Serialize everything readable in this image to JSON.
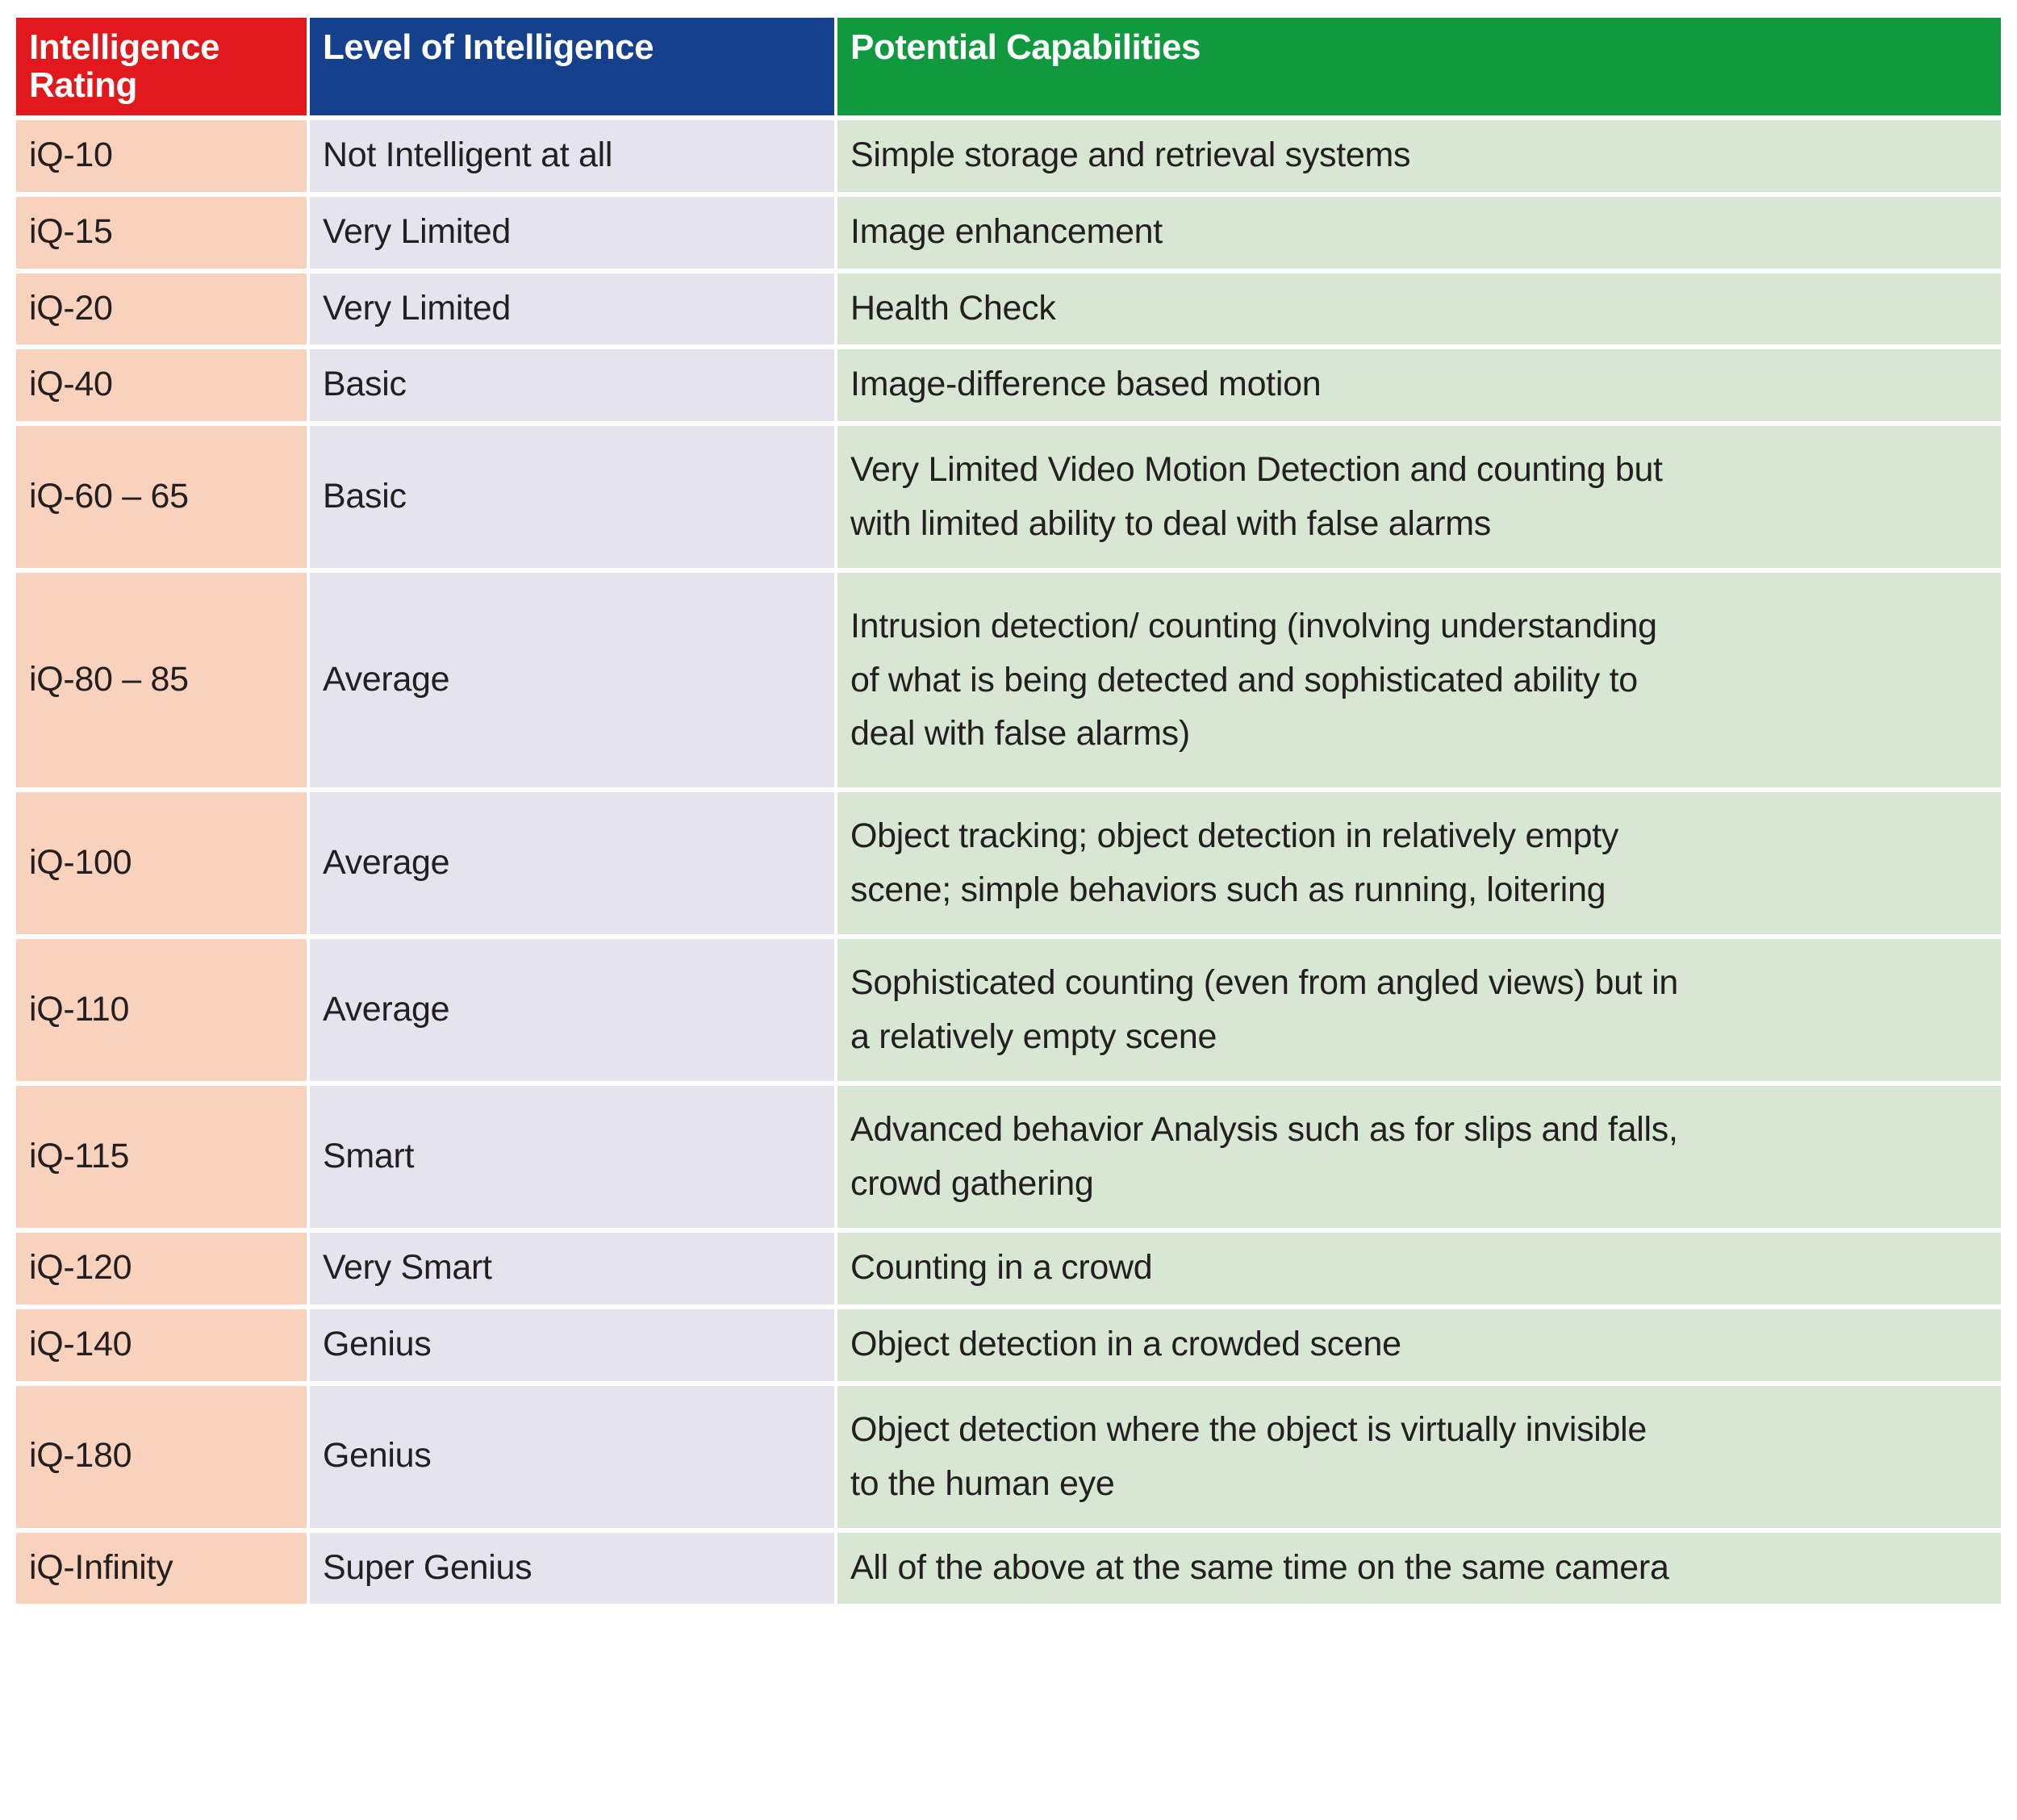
{
  "table": {
    "headers": [
      {
        "id": "rating",
        "label": "Intelligence Rating",
        "color": "#E2191C"
      },
      {
        "id": "level",
        "label": "Level of Intelligence",
        "color": "#15408C"
      },
      {
        "id": "capability",
        "label": "Potential Capabilities",
        "color": "#10993E"
      }
    ],
    "colors": {
      "rating_cell": "#F9D2BD",
      "level_cell": "#E4E3EE",
      "capability_cell": "#D7E7D3",
      "text": "#231F20",
      "header_text": "#FFFFFF"
    },
    "rows": [
      {
        "rating": "iQ-10",
        "level": "Not Intelligent at all",
        "capability_lines": [
          "Simple storage and retrieval systems"
        ]
      },
      {
        "rating": "iQ-15",
        "level": "Very Limited",
        "capability_lines": [
          "Image enhancement"
        ]
      },
      {
        "rating": "iQ-20",
        "level": "Very Limited",
        "capability_lines": [
          "Health Check"
        ]
      },
      {
        "rating": "iQ-40",
        "level": "Basic",
        "capability_lines": [
          "Image-difference based motion"
        ]
      },
      {
        "rating": "iQ-60 – 65",
        "level": "Basic",
        "capability_lines": [
          "Very Limited Video Motion Detection and counting but",
          "with limited ability to deal with false alarms"
        ]
      },
      {
        "rating": "iQ-80 – 85",
        "level": "Average",
        "capability_lines": [
          "Intrusion detection/ counting (involving understanding",
          "of what is being detected and sophisticated ability to",
          "deal with false alarms)"
        ]
      },
      {
        "rating": "iQ-100",
        "level": "Average",
        "capability_lines": [
          "Object tracking; object detection in relatively empty",
          "scene; simple behaviors such as running, loitering"
        ]
      },
      {
        "rating": "iQ-110",
        "level": "Average",
        "capability_lines": [
          "Sophisticated counting (even from angled views) but in",
          "a relatively empty scene"
        ]
      },
      {
        "rating": "iQ-115",
        "level": "Smart",
        "capability_lines": [
          "Advanced behavior Analysis such as for slips and falls,",
          "crowd gathering"
        ]
      },
      {
        "rating": "iQ-120",
        "level": "Very Smart",
        "capability_lines": [
          "Counting in a crowd"
        ]
      },
      {
        "rating": "iQ-140",
        "level": "Genius",
        "capability_lines": [
          "Object detection in a crowded scene"
        ]
      },
      {
        "rating": "iQ-180",
        "level": "Genius",
        "capability_lines": [
          "Object detection where the object is virtually invisible",
          "to the human eye"
        ]
      },
      {
        "rating": "iQ-Infinity",
        "level": "Super Genius",
        "capability_lines": [
          "All of the above at the same time on the same camera"
        ]
      }
    ]
  }
}
